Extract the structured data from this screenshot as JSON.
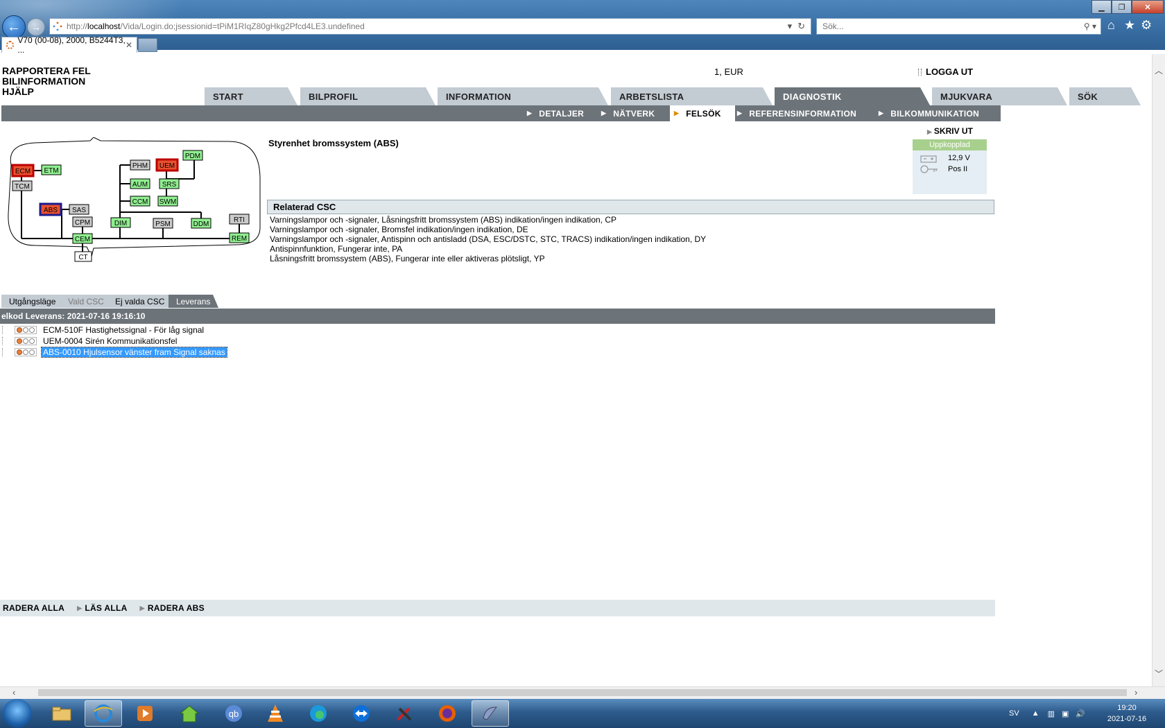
{
  "browser": {
    "url_prefix": "http://",
    "url_host": "localhost",
    "url_path": "/Vida/Login.do;jsessionid=tPiM1RIqZ80gHkg2Pfcd4LE3.undefined",
    "search_placeholder": "Sök...",
    "tab_title": "V70 (00-08), 2000, B5244T3, ..."
  },
  "header": {
    "links": [
      "RAPPORTERA FEL",
      "BILINFORMATION",
      "HJÄLP"
    ],
    "account": "1, EUR",
    "logout": "LOGGA UT"
  },
  "menu_tabs": [
    "START",
    "BILPROFIL",
    "INFORMATION",
    "ARBETSLISTA",
    "DIAGNOSTIK",
    "MJUKVARA",
    "SÖK"
  ],
  "sub_nav": [
    "DETALJER",
    "NÄTVERK",
    "FELSÖK",
    "REFERENSINFORMATION",
    "BILKOMMUNIKATION"
  ],
  "network": {
    "modules": [
      "ECM",
      "ETM",
      "TCM",
      "ABS",
      "SAS",
      "CPM",
      "CEM",
      "CT",
      "PHM",
      "UEM",
      "PDM",
      "AUM",
      "SRS",
      "CCM",
      "SWM",
      "DIM",
      "PSM",
      "DDM",
      "RTI",
      "REM"
    ]
  },
  "ecu_title": "Styrenhet bromssystem (ABS)",
  "print_label": "SKRIV UT",
  "status": {
    "connection": "Uppkopplad",
    "voltage": "12,9 V",
    "ignition": "Pos II"
  },
  "related_csc": {
    "title": "Relaterad CSC",
    "items": [
      "Varningslampor och -signaler, Låsningsfritt bromssystem (ABS) indikation/ingen indikation, CP",
      "Varningslampor och -signaler, Bromsfel indikation/ingen indikation, DE",
      "Varningslampor och -signaler, Antispinn och antisladd (DSA, ESC/DSTC, STC, TRACS) indikation/ingen indikation, DY",
      "Antispinnfunktion, Fungerar inte, PA",
      "Låsningsfritt bromssystem (ABS), Fungerar inte eller aktiveras plötsligt, YP"
    ]
  },
  "sub_tabs": [
    "Utgångsläge",
    "Vald CSC",
    "Ej valda CSC",
    "Leverans"
  ],
  "delivery_header": "elkod Leverans: 2021-07-16 19:16:10",
  "dtcs": [
    "ECM-510F Hastighetssignal - För låg signal",
    "UEM-0004 Sirén Kommunikationsfel",
    "ABS-0010 Hjulsensor vänster fram Signal saknas"
  ],
  "bottom_actions": [
    "RADERA ALLA",
    "LÄS ALLA",
    "RADERA ABS"
  ],
  "taskbar": {
    "lang": "SV",
    "time": "19:20",
    "date": "2021-07-16"
  },
  "colors": {
    "tab_inactive": "#c3cbd3",
    "tab_active": "#6c7379",
    "module_ok": "#90ee90",
    "module_fault": "#e8502f",
    "module_nocomm": "#cccccc",
    "selection": "#3399ff",
    "online": "#a8d08d"
  }
}
